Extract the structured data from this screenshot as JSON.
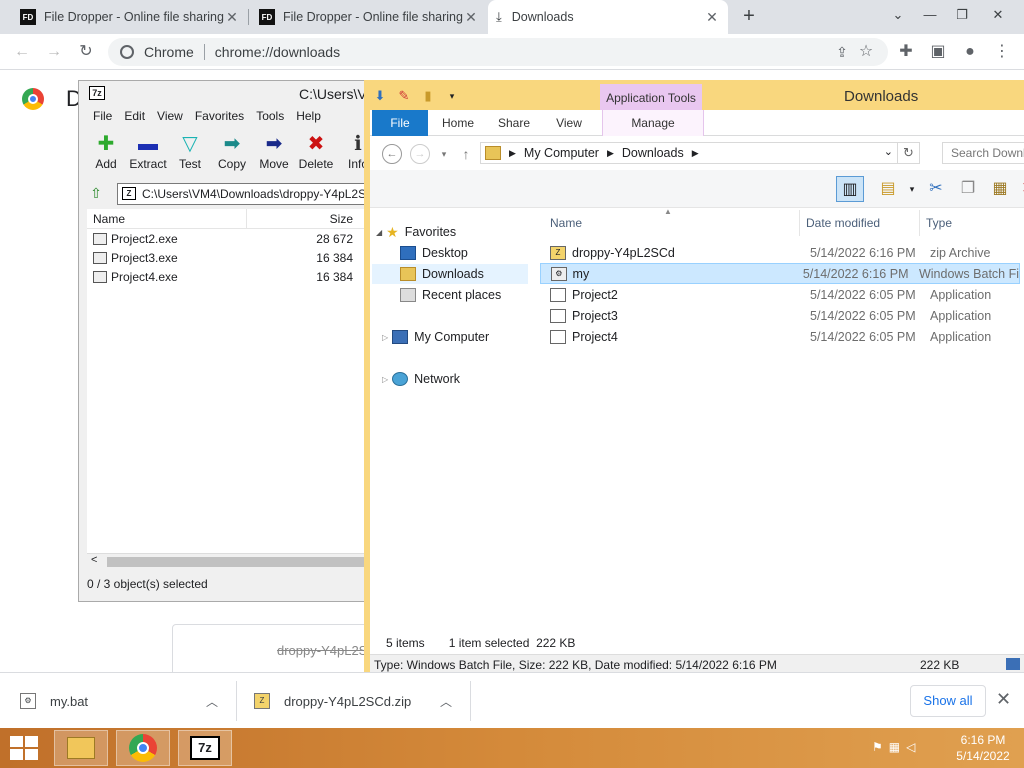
{
  "tabs": [
    {
      "favicon": "FD",
      "title": "File Dropper - Online file sharing"
    },
    {
      "favicon": "FD",
      "title": "File Dropper - Online file sharing"
    },
    {
      "favicon": "download-icon",
      "title": "Downloads"
    }
  ],
  "omnibox": {
    "site": "Chrome",
    "url": "chrome://downloads"
  },
  "page": {
    "title_initial": "D",
    "card_filename": "droppy-Y4pL2S"
  },
  "sevenzip": {
    "title": "C:\\Users\\V",
    "menu": [
      "File",
      "Edit",
      "View",
      "Favorites",
      "Tools",
      "Help"
    ],
    "tools": [
      {
        "icon": "add-icon",
        "label": "Add",
        "color": "#2eaa2e"
      },
      {
        "icon": "extract-icon",
        "label": "Extract",
        "color": "#1c2fb3"
      },
      {
        "icon": "test-icon",
        "label": "Test",
        "color": "#1ab3b3"
      },
      {
        "icon": "copy-icon",
        "label": "Copy",
        "color": "#1b8a8a"
      },
      {
        "icon": "move-icon",
        "label": "Move",
        "color": "#1a2a8a"
      },
      {
        "icon": "delete-icon",
        "label": "Delete",
        "color": "#cc1111"
      },
      {
        "icon": "info-icon",
        "label": "Info",
        "color": "#333333"
      }
    ],
    "path": "C:\\Users\\VM4\\Downloads\\droppy-Y4pL2S",
    "columns": {
      "name": "Name",
      "size": "Size"
    },
    "files": [
      {
        "name": "Project2.exe",
        "size": "28 672"
      },
      {
        "name": "Project3.exe",
        "size": "16 384"
      },
      {
        "name": "Project4.exe",
        "size": "16 384"
      }
    ],
    "status": "0 / 3 object(s) selected"
  },
  "explorer": {
    "title": "Downloads",
    "context_tab": "Application Tools",
    "ribbon_tabs": [
      "File",
      "Home",
      "Share",
      "View",
      "Manage"
    ],
    "breadcrumb": [
      "My Computer",
      "Downloads"
    ],
    "search_placeholder": "Search Downl",
    "nav": {
      "favorites": "Favorites",
      "desktop": "Desktop",
      "downloads": "Downloads",
      "recent": "Recent places",
      "computer": "My Computer",
      "network": "Network"
    },
    "columns": {
      "name": "Name",
      "date": "Date modified",
      "type": "Type"
    },
    "files": [
      {
        "name": "droppy-Y4pL2SCd",
        "date": "5/14/2022 6:16 PM",
        "type": "zip Archive",
        "icon": "zip-icon"
      },
      {
        "name": "my",
        "date": "5/14/2022 6:16 PM",
        "type": "Windows Batch Fi",
        "icon": "batch-file-icon"
      },
      {
        "name": "Project2",
        "date": "5/14/2022 6:05 PM",
        "type": "Application",
        "icon": "application-icon"
      },
      {
        "name": "Project3",
        "date": "5/14/2022 6:05 PM",
        "type": "Application",
        "icon": "application-icon"
      },
      {
        "name": "Project4",
        "date": "5/14/2022 6:05 PM",
        "type": "Application",
        "icon": "application-icon"
      }
    ],
    "status_items": "5 items",
    "status_selected": "1 item selected  222 KB",
    "detail": "Type: Windows Batch File, Size: 222 KB, Date modified: 5/14/2022 6:16 PM",
    "detail_size": "222 KB"
  },
  "shelf": {
    "items": [
      {
        "name": "my.bat"
      },
      {
        "name": "droppy-Y4pL2SCd.zip"
      }
    ],
    "show_all": "Show all"
  },
  "taskbar": {
    "time": "6:16 PM",
    "date": "5/14/2022"
  }
}
